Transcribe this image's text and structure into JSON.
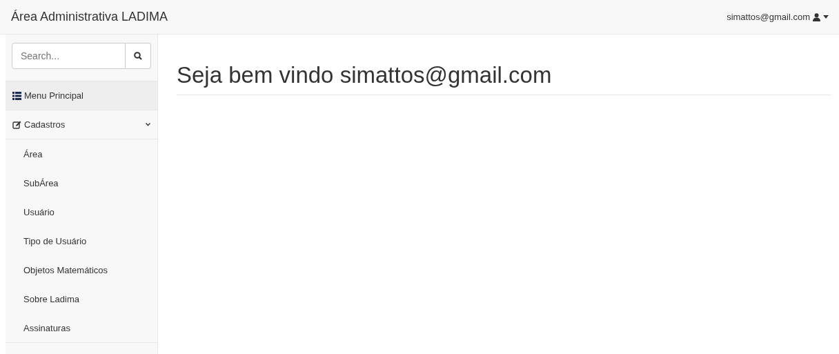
{
  "navbar": {
    "brand": "Área Administrativa LADIMA",
    "user": "simattos@gmail.com"
  },
  "sidebar": {
    "search": {
      "placeholder": "Search..."
    },
    "items": [
      {
        "label": "Menu Principal",
        "kind": "header"
      },
      {
        "label": "Cadastros",
        "kind": "group",
        "expanded": true,
        "children": [
          {
            "label": "Área"
          },
          {
            "label": "SubÁrea"
          },
          {
            "label": "Usuário"
          },
          {
            "label": "Tipo de Usuário"
          },
          {
            "label": "Objetos Matemáticos"
          },
          {
            "label": "Sobre Ladima"
          },
          {
            "label": "Assinaturas"
          }
        ]
      }
    ]
  },
  "main": {
    "heading": "Seja bem vindo simattos@gmail.com"
  }
}
